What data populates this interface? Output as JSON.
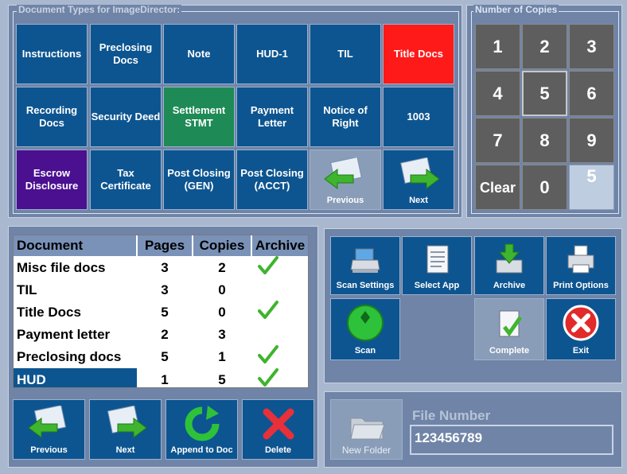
{
  "doc_types": {
    "legend": "Document Types for ImageDirector:",
    "buttons": [
      "Instructions",
      "Preclosing Docs",
      "Note",
      "HUD-1",
      "TIL",
      "Title Docs",
      "Recording Docs",
      "Security Deed",
      "Settlement STMT",
      "Payment Letter",
      "Notice of Right",
      "1003",
      "Escrow Disclosure",
      "Tax Certificate",
      "Post Closing (GEN)",
      "Post Closing (ACCT)"
    ],
    "previous_label": "Previous",
    "next_label": "Next"
  },
  "copies": {
    "legend": "Number of Copies",
    "keys": [
      "1",
      "2",
      "3",
      "4",
      "5",
      "6",
      "7",
      "8",
      "9"
    ],
    "clear_label": "Clear",
    "zero_label": "0",
    "display_value": "5"
  },
  "doc_table": {
    "headers": [
      "Document",
      "Pages",
      "Copies",
      "Archive"
    ],
    "rows": [
      {
        "document": "Misc file docs",
        "pages": "3",
        "copies": "2",
        "archive": true
      },
      {
        "document": "TIL",
        "pages": "3",
        "copies": "0",
        "archive": false
      },
      {
        "document": "Title Docs",
        "pages": "5",
        "copies": "0",
        "archive": true
      },
      {
        "document": "Payment letter",
        "pages": "2",
        "copies": "3",
        "archive": false
      },
      {
        "document": "Preclosing docs",
        "pages": "5",
        "copies": "1",
        "archive": true
      },
      {
        "document": "HUD",
        "pages": "1",
        "copies": "5",
        "archive": true
      }
    ]
  },
  "list_actions": {
    "previous_label": "Previous",
    "next_label": "Next",
    "append_label": "Append to Doc",
    "delete_label": "Delete"
  },
  "actions": {
    "scan_settings_label": "Scan Settings",
    "select_app_label": "Select App",
    "archive_label": "Archive",
    "print_options_label": "Print Options",
    "scan_label": "Scan",
    "complete_label": "Complete",
    "exit_label": "Exit"
  },
  "file": {
    "new_folder_label": "New Folder",
    "file_number_label": "File Number",
    "file_number_value": "123456789"
  }
}
